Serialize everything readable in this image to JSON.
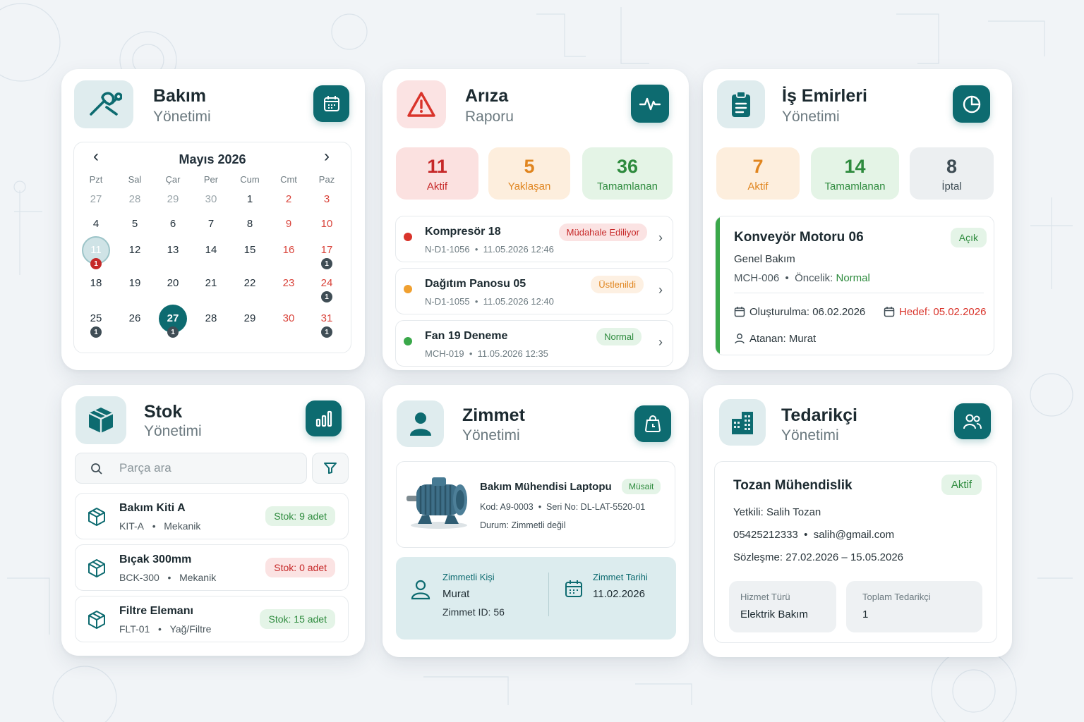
{
  "colors": {
    "accent": "#0d6b70",
    "danger": "#c62828",
    "warning": "#e0851f",
    "success": "#2e8b3e"
  },
  "bakim": {
    "title": "Bakım",
    "subtitle": "Yönetimi",
    "icon": "wrench-icon",
    "action_icon": "calendar-icon",
    "calendar": {
      "month": "Mayıs 2026",
      "prev": "‹",
      "next": "›",
      "weekdays": [
        "Pzt",
        "Sal",
        "Çar",
        "Per",
        "Cum",
        "Cmt",
        "Paz"
      ],
      "weeks": [
        [
          "27",
          "28",
          "29",
          "30",
          "1",
          "2",
          "3"
        ],
        [
          "4",
          "5",
          "6",
          "7",
          "8",
          "9",
          "10"
        ],
        [
          "11",
          "12",
          "13",
          "14",
          "15",
          "16",
          "17"
        ],
        [
          "18",
          "19",
          "20",
          "21",
          "22",
          "23",
          "24"
        ],
        [
          "25",
          "26",
          "27",
          "28",
          "29",
          "30",
          "31"
        ]
      ],
      "event_badges": [
        {
          "week": 2,
          "day": 0,
          "count": "1",
          "kind": "red"
        },
        {
          "week": 2,
          "day": 6,
          "count": "1",
          "kind": "dark"
        },
        {
          "week": 3,
          "day": 6,
          "count": "1",
          "kind": "dark"
        },
        {
          "week": 4,
          "day": 0,
          "count": "1",
          "kind": "dark"
        },
        {
          "week": 4,
          "day": 2,
          "count": "1",
          "kind": "dark"
        },
        {
          "week": 4,
          "day": 6,
          "count": "1",
          "kind": "dark"
        }
      ],
      "today": "27",
      "selected": "11"
    }
  },
  "ariza": {
    "title": "Arıza",
    "subtitle": "Raporu",
    "icon": "warning-triangle-icon",
    "action_icon": "pulse-icon",
    "stats": [
      {
        "value": "11",
        "label": "Aktif"
      },
      {
        "value": "5",
        "label": "Yaklaşan"
      },
      {
        "value": "36",
        "label": "Tamamlanan"
      }
    ],
    "items": [
      {
        "title": "Kompresör 18",
        "code": "N-D1-1056",
        "date": "11.05.2026 12:46",
        "badge": "Müdahale Ediliyor",
        "dot": "#d9342b"
      },
      {
        "title": "Dağıtım Panosu 05",
        "code": "N-D1-1055",
        "date": "11.05.2026 12:40",
        "badge": "Üstlenildi",
        "dot": "#f0a030"
      },
      {
        "title": "Fan 19 Deneme",
        "code": "MCH-019",
        "date": "11.05.2026 12:35",
        "badge": "Normal",
        "dot": "#3aa84a"
      }
    ],
    "sep": "•",
    "chevron": "›"
  },
  "is": {
    "title": "İş Emirleri",
    "subtitle": "Yönetimi",
    "icon": "clipboard-icon",
    "action_icon": "pie-chart-icon",
    "stats": [
      {
        "value": "7",
        "label": "Aktif"
      },
      {
        "value": "14",
        "label": "Tamamlanan"
      },
      {
        "value": "8",
        "label": "İptal"
      }
    ],
    "order": {
      "title": "Konveyör Motoru 06",
      "badge": "Açık",
      "type": "Genel Bakım",
      "code": "MCH-006",
      "sep": "•",
      "priority_label": "Öncelik:",
      "priority": "Normal",
      "created": "Oluşturulma: 06.02.2026",
      "target": "Hedef: 05.02.2026",
      "assignee": "Atanan: Murat"
    }
  },
  "stok": {
    "title": "Stok",
    "subtitle": "Yönetimi",
    "icon": "box-icon",
    "action_icon": "bar-chart-icon",
    "search_placeholder": "Parça ara",
    "items": [
      {
        "title": "Bakım Kiti A",
        "code": "KIT-A",
        "category": "Mekanik",
        "badge": "Stok: 9 adet",
        "ok": true
      },
      {
        "title": "Bıçak 300mm",
        "code": "BCK-300",
        "category": "Mekanik",
        "badge": "Stok: 0 adet",
        "ok": false
      },
      {
        "title": "Filtre Elemanı",
        "code": "FLT-01",
        "category": "Yağ/Filtre",
        "badge": "Stok: 15 adet",
        "ok": true
      }
    ],
    "sep": "•"
  },
  "zimmet": {
    "title": "Zimmet",
    "subtitle": "Yönetimi",
    "icon": "user-icon",
    "action_icon": "clock-bag-icon",
    "asset": {
      "name": "Bakım Mühendisi Laptopu",
      "badge": "Müsait",
      "code": "Kod: A9-0003",
      "serial": "Seri No: DL-LAT-5520-01",
      "status": "Durum: Zimmetli değil"
    },
    "assign": {
      "person_label": "Zimmetli Kişi",
      "person": "Murat",
      "id": "Zimmet ID: 56",
      "date_label": "Zimmet Tarihi",
      "date": "11.02.2026"
    }
  },
  "tedarikci": {
    "title": "Tedarikçi",
    "subtitle": "Yönetimi",
    "icon": "building-icon",
    "action_icon": "users-icon",
    "supplier": {
      "name": "Tozan Mühendislik",
      "badge": "Aktif",
      "contact": "Yetkili: Salih Tozan",
      "phone": "05425212333",
      "sep": "•",
      "email": "salih@gmail.com",
      "contract": "Sözleşme: 27.02.2026 – 15.05.2026",
      "service_label": "Hizmet Türü",
      "service": "Elektrik Bakım",
      "total_label": "Toplam Tedarikçi",
      "total": "1"
    }
  }
}
